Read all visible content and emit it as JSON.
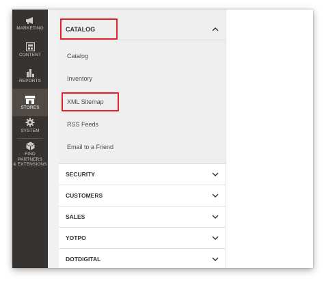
{
  "admin_nav": {
    "items": [
      {
        "label": "MARKETING",
        "icon": "megaphone-icon"
      },
      {
        "label": "CONTENT",
        "icon": "content-icon"
      },
      {
        "label": "REPORTS",
        "icon": "bar-chart-icon"
      },
      {
        "label": "STORES",
        "icon": "store-icon"
      },
      {
        "label": "SYSTEM",
        "icon": "gear-icon"
      },
      {
        "label_line1": "FIND PARTNERS",
        "label_line2": "& EXTENSIONS",
        "icon": "cube-icon"
      }
    ],
    "active": "STORES"
  },
  "flyout": {
    "open_section": {
      "title": "CATALOG",
      "items": [
        "Catalog",
        "Inventory",
        "XML Sitemap",
        "RSS Feeds",
        "Email to a Friend"
      ],
      "highlighted": [
        "CATALOG",
        "XML Sitemap"
      ]
    },
    "collapsed_sections": [
      "SECURITY",
      "CUSTOMERS",
      "SALES",
      "YOTPO",
      "DOTDIGITAL"
    ]
  },
  "colors": {
    "nav_bg": "#373330",
    "nav_active_bg": "#514943",
    "highlight": "#e0202a"
  }
}
